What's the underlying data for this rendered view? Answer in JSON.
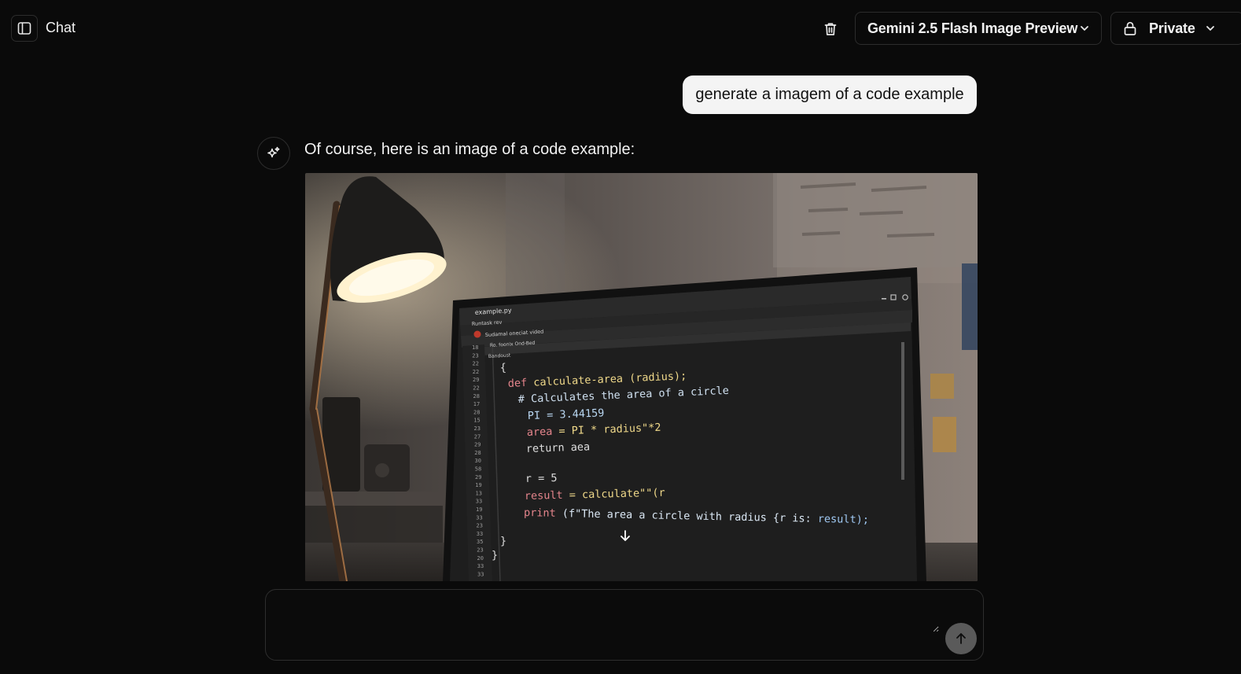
{
  "header": {
    "title": "Chat",
    "model_label": "Gemini 2.5 Flash Image Preview",
    "visibility_label": "Private"
  },
  "conversation": {
    "user_message": "generate a imagem of a code example",
    "assistant_text": "Of course, here is an image of a code example:"
  },
  "image": {
    "tab_name": "example.py",
    "breadcrumb_1": "Runtask rev",
    "breadcrumb_2": "Sudamal oneciat vided",
    "panel_1": "Ro. foonix Ond-Bed",
    "panel_2": "Bandoust",
    "line_numbers": [
      "18",
      "23",
      "22",
      "22",
      "29",
      "22",
      "28",
      "17",
      "28",
      "15",
      "23",
      "27",
      "29",
      "28",
      "30",
      "58",
      "29",
      "19",
      "13",
      "33",
      "19",
      "33",
      "23",
      "33",
      "35",
      "23",
      "20",
      "33",
      "33"
    ],
    "code": {
      "open_brace": "{",
      "def_kw": "def",
      "def_name": "calculate-area",
      "def_args": "(radius);",
      "comment": "# Calculates the area of a circle",
      "pi_line": "PI = 3.44159",
      "area_var": "area",
      "area_expr": " = PI * radius\"*2",
      "return_line": "return aea",
      "r_line": "r = 5",
      "result_var": "result",
      "result_expr": " = calculate\"\"(r",
      "print_fn": "print",
      "print_str": "(f\"The area a circle with radius {r is: ",
      "print_end": "result);",
      "close_brace_1": "}",
      "close_brace_2": "}"
    }
  },
  "composer": {
    "placeholder": ""
  },
  "colors": {
    "background": "#0a0a0a",
    "border": "#2c2c2c",
    "user_bubble": "#f4f4f4",
    "send_button": "#5a5a5a"
  }
}
